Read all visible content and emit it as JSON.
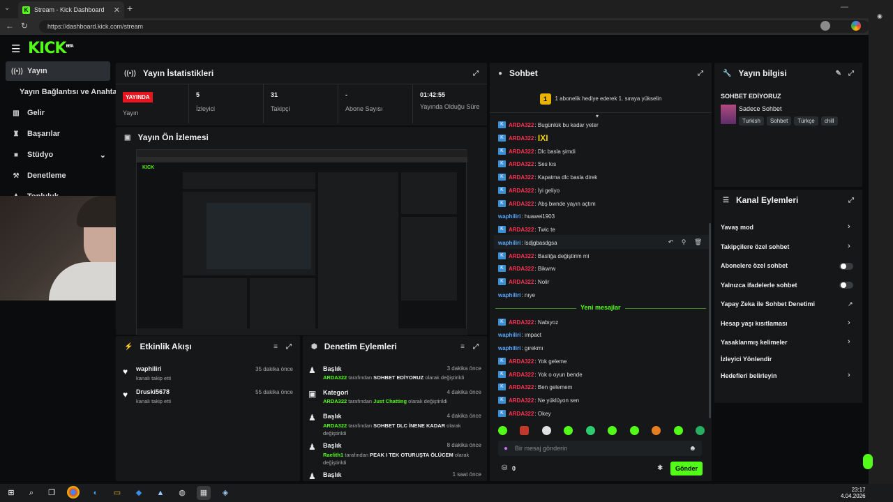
{
  "browser": {
    "tab_title": "Stream - Kick Dashboard",
    "tab_close": "✕",
    "new_tab": "+",
    "url": "https://dashboard.kick.com/stream"
  },
  "app": {
    "logo": "KICK",
    "logo_sup": "BETA"
  },
  "sidebar": {
    "items": [
      {
        "label": "Yayın",
        "icon": "broadcast-icon"
      },
      {
        "label": "Yayın Bağlantısı ve Anahtarı",
        "icon": ""
      },
      {
        "label": "Gelir",
        "icon": "chart-icon"
      },
      {
        "label": "Başarılar",
        "icon": "trophy-icon"
      },
      {
        "label": "Stüdyo",
        "icon": "camera-icon"
      },
      {
        "label": "Denetleme",
        "icon": "hammer-icon"
      },
      {
        "label": "Topluluk",
        "icon": "people-icon"
      }
    ]
  },
  "stats": {
    "title": "Yayın İstatistikleri",
    "live_badge": "YAYINDA",
    "live_label": "Yayın",
    "viewers_value": "5",
    "viewers_label": "İzleyici",
    "followers_value": "31",
    "followers_label": "Takipçi",
    "subs_value": "-",
    "subs_label": "Abone Sayısı",
    "uptime_value": "01:42:55",
    "uptime_label": "Yayında Olduğu Süre"
  },
  "preview": {
    "title": "Yayın Ön İzlemesi"
  },
  "activity": {
    "title": "Etkinlik Akışı",
    "items": [
      {
        "user": "waphiliri",
        "action": "kanalı takip etti",
        "time": "35 dakika önce"
      },
      {
        "user": "Druski5678",
        "action": "kanalı takip etti",
        "time": "55 dakika önce"
      }
    ]
  },
  "moderation": {
    "title": "Denetim Eylemleri",
    "items": [
      {
        "type": "Başlık",
        "by": "ARDA322",
        "mid": "tarafından",
        "value": "SOHBET EDİYORUZ",
        "end": "olarak değiştirildi",
        "time": "3 dakika önce"
      },
      {
        "type": "Kategori",
        "by": "ARDA322",
        "mid": "tarafından",
        "value": "Just Chatting",
        "end": "olarak değiştirildi",
        "time": "4 dakika önce"
      },
      {
        "type": "Başlık",
        "by": "ARDA322",
        "mid": "tarafından",
        "value": "SOHBET DLC İNENE KADAR",
        "end": "olarak değiştirildi",
        "time": "4 dakika önce"
      },
      {
        "type": "Başlık",
        "by": "Raelith1",
        "mid": "tarafından",
        "value": "PEAK I TEK OTURUŞTA ÖLÜCEM",
        "end": "olarak değiştirildi",
        "time": "8 dakika önce"
      },
      {
        "type": "Başlık",
        "by": "",
        "mid": "",
        "value": "",
        "end": "",
        "time": "1 saat önce"
      }
    ]
  },
  "chat": {
    "title": "Sohbet",
    "gift_banner": "1 abonelik hediye ederek 1. sıraya yükselin",
    "gift_rank": "1",
    "new_messages": "Yeni mesajlar",
    "messages": [
      {
        "user": "ARDA322",
        "text": "Bugünlük bu kadar yeter",
        "color": "red",
        "badge": true
      },
      {
        "user": "ARDA322",
        "text": "IXI",
        "color": "red",
        "badge": true
      },
      {
        "user": "ARDA322",
        "text": "Dlc basla şimdi",
        "color": "red",
        "badge": true
      },
      {
        "user": "ARDA322",
        "text": "Ses kıs",
        "color": "red",
        "badge": true
      },
      {
        "user": "ARDA322",
        "text": "Kapatma dlc basla direk",
        "color": "red",
        "badge": true
      },
      {
        "user": "ARDA322",
        "text": "İyi geliyo",
        "color": "red",
        "badge": true
      },
      {
        "user": "ARDA322",
        "text": "Abş bwnde yayın açtım",
        "color": "red",
        "badge": true
      },
      {
        "user": "waphiliri",
        "text": "huawei1903",
        "color": "blue",
        "badge": false
      },
      {
        "user": "ARDA322",
        "text": "Twic te",
        "color": "red",
        "badge": true
      },
      {
        "user": "waphiliri",
        "text": "lsdjgbasdgsa",
        "color": "blue",
        "badge": false
      },
      {
        "user": "ARDA322",
        "text": "Basliğa değiştirim mi",
        "color": "red",
        "badge": true
      },
      {
        "user": "ARDA322",
        "text": "Bikwrw",
        "color": "red",
        "badge": true
      },
      {
        "user": "ARDA322",
        "text": "Nolir",
        "color": "red",
        "badge": true
      },
      {
        "user": "waphiliri",
        "text": "nıye",
        "color": "blue",
        "badge": false
      },
      {
        "user": "ARDA322",
        "text": "Nabıyoz",
        "color": "red",
        "badge": true
      },
      {
        "user": "waphiliri",
        "text": "ımpact",
        "color": "blue",
        "badge": false
      },
      {
        "user": "waphiliri",
        "text": "gırekmı",
        "color": "blue",
        "badge": false
      },
      {
        "user": "ARDA322",
        "text": "Yok geleme",
        "color": "red",
        "badge": true
      },
      {
        "user": "ARDA322",
        "text": "Yok o oyun bende",
        "color": "red",
        "badge": true
      },
      {
        "user": "ARDA322",
        "text": "Ben gelemem",
        "color": "red",
        "badge": true
      },
      {
        "user": "ARDA322",
        "text": "Ne yüklüyon sen",
        "color": "red",
        "badge": true
      },
      {
        "user": "ARDA322",
        "text": "Okey",
        "color": "red",
        "badge": true
      }
    ],
    "input_placeholder": "Bir mesaj gönderin",
    "points": "0",
    "send_label": "Gönder"
  },
  "stream_info": {
    "title": "Yayın bilgisi",
    "stream_title": "SOHBET EDİYORUZ",
    "category": "Sadece Sohbet",
    "tags": [
      "Turkish",
      "Sohbet",
      "Türkçe",
      "chill"
    ]
  },
  "channel_actions": {
    "title": "Kanal Eylemleri",
    "items": [
      {
        "label": "Yavaş mod",
        "control": "chevron"
      },
      {
        "label": "Takipçilere özel sohbet",
        "control": "chevron"
      },
      {
        "label": "Abonelere özel sohbet",
        "control": "toggle"
      },
      {
        "label": "Yalnızca ifadelerle sohbet",
        "control": "toggle"
      },
      {
        "label": "Yapay Zeka ile Sohbet Denetimi",
        "control": "external"
      },
      {
        "label": "Hesap yaşı kısıtlaması",
        "control": "chevron"
      },
      {
        "label": "Yasaklanmış kelimeler",
        "control": "chevron"
      },
      {
        "label": "İzleyici Yönlendir",
        "control": "none"
      },
      {
        "label": "Hedefleri belirleyin",
        "control": "chevron"
      }
    ]
  },
  "taskbar": {
    "time": "23:17",
    "date": "4.04.2026"
  }
}
